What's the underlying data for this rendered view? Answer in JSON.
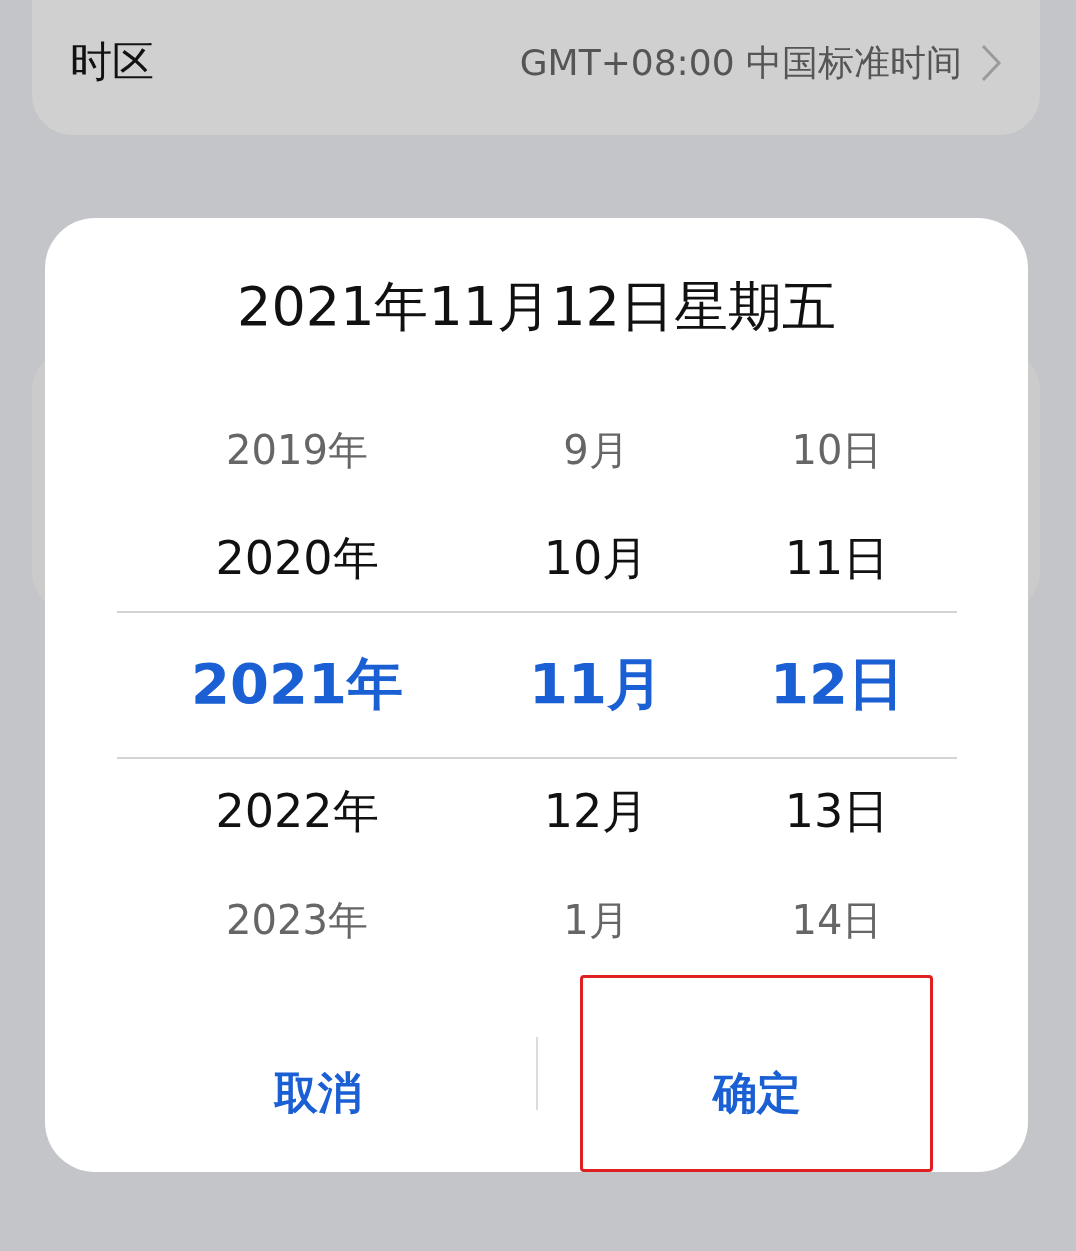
{
  "background": {
    "setting": {
      "label": "时区",
      "value": "GMT+08:00 中国标准时间"
    }
  },
  "dialog": {
    "title": "2021年11月12日星期五",
    "columns": [
      {
        "items": [
          {
            "label": "2019年",
            "selected": false
          },
          {
            "label": "2020年",
            "selected": false
          },
          {
            "label": "2021年",
            "selected": true
          },
          {
            "label": "2022年",
            "selected": false
          },
          {
            "label": "2023年",
            "selected": false
          }
        ]
      },
      {
        "items": [
          {
            "label": "9月",
            "selected": false
          },
          {
            "label": "10月",
            "selected": false
          },
          {
            "label": "11月",
            "selected": true
          },
          {
            "label": "12月",
            "selected": false
          },
          {
            "label": "1月",
            "selected": false
          }
        ]
      },
      {
        "items": [
          {
            "label": "10日",
            "selected": false
          },
          {
            "label": "11日",
            "selected": false
          },
          {
            "label": "12日",
            "selected": true
          },
          {
            "label": "13日",
            "selected": false
          },
          {
            "label": "14日",
            "selected": false
          }
        ]
      }
    ],
    "buttons": [
      {
        "label": "取消",
        "highlighted": false
      },
      {
        "label": "确定",
        "highlighted": true
      }
    ]
  }
}
